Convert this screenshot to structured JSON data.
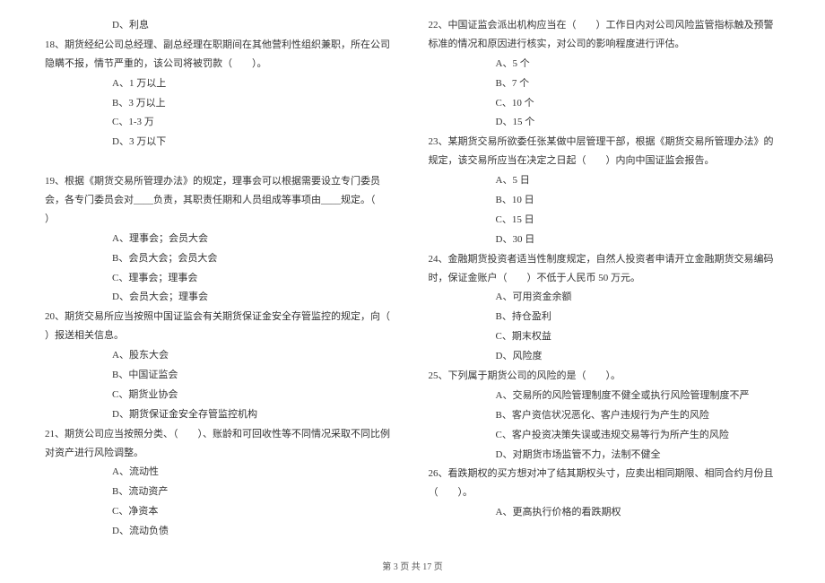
{
  "left": {
    "l0": "D、利息",
    "q18": "18、期货经纪公司总经理、副总经理在职期间在其他营利性组织兼职，所在公司隐瞒不报，情节严重的，该公司将被罚款（　　）。",
    "q18a": "A、1 万以上",
    "q18b": "B、3 万以上",
    "q18c": "C、1-3 万",
    "q18d": "D、3 万以下",
    "q19": "19、根据《期货交易所管理办法》的规定，理事会可以根据需要设立专门委员会，各专门委员会对____负责，其职责任期和人员组成等事项由____规定。（　　）",
    "q19a": "A、理事会；会员大会",
    "q19b": "B、会员大会；会员大会",
    "q19c": "C、理事会；理事会",
    "q19d": "D、会员大会；理事会",
    "q20": "20、期货交易所应当按照中国证监会有关期货保证金安全存管监控的规定，向（　　）报送相关信息。",
    "q20a": "A、股东大会",
    "q20b": "B、中国证监会",
    "q20c": "C、期货业协会",
    "q20d": "D、期货保证金安全存管监控机构",
    "q21": "21、期货公司应当按照分类、（　　）、账龄和可回收性等不同情况采取不同比例对资产进行风险调整。",
    "q21a": "A、流动性",
    "q21b": "B、流动资产",
    "q21c": "C、净资本",
    "q21d": "D、流动负债"
  },
  "right": {
    "q22": "22、中国证监会派出机构应当在（　　）工作日内对公司风险监管指标触及预警标准的情况和原因进行核实，对公司的影响程度进行评估。",
    "q22a": "A、5 个",
    "q22b": "B、7 个",
    "q22c": "C、10 个",
    "q22d": "D、15 个",
    "q23": "23、某期货交易所欲委任张某做中层管理干部，根据《期货交易所管理办法》的规定，该交易所应当在决定之日起（　　）内向中国证监会报告。",
    "q23a": "A、5 日",
    "q23b": "B、10 日",
    "q23c": "C、15 日",
    "q23d": "D、30 日",
    "q24": "24、金融期货投资者适当性制度规定，自然人投资者申请开立金融期货交易编码时，保证金账户（　　）不低于人民币 50 万元。",
    "q24a": "A、可用资金余额",
    "q24b": "B、持仓盈利",
    "q24c": "C、期末权益",
    "q24d": "D、风险度",
    "q25": "25、下列属于期货公司的风险的是（　　）。",
    "q25a": "A、交易所的风险管理制度不健全或执行风险管理制度不严",
    "q25b": "B、客户资信状况恶化、客户违规行为产生的风险",
    "q25c": "C、客户投资决策失误或违规交易等行为所产生的风险",
    "q25d": "D、对期货市场监管不力，法制不健全",
    "q26": "26、看跌期权的买方想对冲了结其期权头寸，应卖出相同期限、相同合约月份且（　　）。",
    "q26a": "A、更高执行价格的看跌期权"
  },
  "footer": "第 3 页 共 17 页"
}
